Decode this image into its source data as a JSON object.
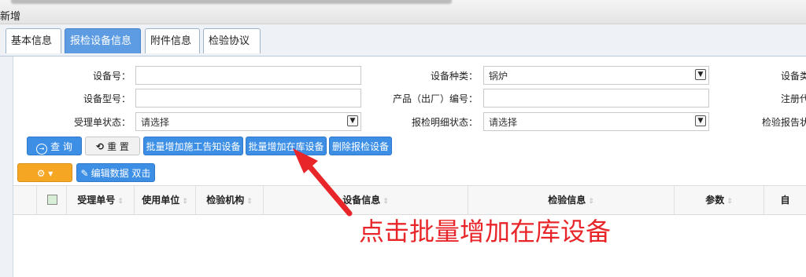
{
  "window": {
    "title": "新增"
  },
  "tabs": [
    {
      "label": "基本信息"
    },
    {
      "label": "报检设备信息",
      "active": true
    },
    {
      "label": "附件信息"
    },
    {
      "label": "检验协议"
    }
  ],
  "form": {
    "row1": {
      "device_no_label": "设备号：",
      "device_no_value": "",
      "device_type_label": "设备种类：",
      "device_type_value": "锅炉",
      "cut_label_1": "设备类"
    },
    "row2": {
      "model_label": "设备型号：",
      "model_value": "",
      "product_no_label": "产品（出厂）编号：",
      "product_no_value": "",
      "cut_label_2": "注册代"
    },
    "row3": {
      "accept_status_label": "受理单状态：",
      "accept_status_value": "请选择",
      "detail_status_label": "报检明细状态：",
      "detail_status_value": "请选择",
      "cut_label_3": "检验报告状"
    }
  },
  "toolbar": {
    "query": "查 询",
    "reset": "重 置",
    "batch_add_notice": "批量增加施工告知设备",
    "batch_add_stock": "批量增加在库设备",
    "delete_device": "删除报检设备",
    "gear_menu": "▾",
    "edit_data": "编辑数据 双击"
  },
  "grid": {
    "columns": [
      "受理单号",
      "使用单位",
      "检验机构",
      "设备信息",
      "检验信息",
      "参数",
      "自"
    ]
  },
  "annotation": {
    "text": "点击批量增加在库设备",
    "color": "#e8262a"
  },
  "colors": {
    "accent": "#3d8fe6",
    "tab_active": "#5d9ce2",
    "orange": "#f5a623"
  }
}
